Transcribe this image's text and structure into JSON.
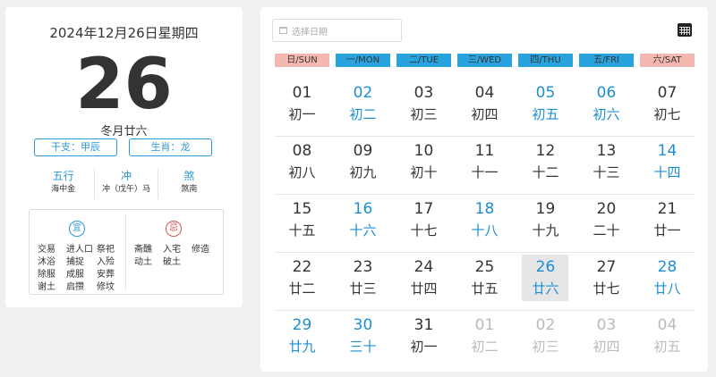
{
  "left": {
    "full_date": "2024年12月26日星期四",
    "big_day": "26",
    "lunar": "冬月廿六",
    "ganzhi": "干支：甲辰",
    "shengxiao": "生肖：龙",
    "wuxing": {
      "title": "五行",
      "value": "海中金"
    },
    "chong": {
      "title": "冲",
      "value": "冲（戊午）马"
    },
    "sha": {
      "title": "煞",
      "value": "煞南"
    },
    "yi": {
      "badge": "宜",
      "items": [
        "交易",
        "进人口",
        "祭祀",
        "沐浴",
        "捕捉",
        "入殓",
        "除服",
        "成服",
        "安葬",
        "谢土",
        "启攒",
        "修坟"
      ]
    },
    "ji": {
      "badge": "忌",
      "items": [
        "斋醮",
        "入宅",
        "修造",
        "动土",
        "破土"
      ]
    }
  },
  "right": {
    "date_placeholder": "选择日期",
    "weekdays": [
      "日/SUN",
      "一/MON",
      "二/TUE",
      "三/WED",
      "四/THU",
      "五/FRI",
      "六/SAT"
    ],
    "weeks": [
      [
        {
          "d": "01",
          "l": "初一",
          "s": "n"
        },
        {
          "d": "02",
          "l": "初二",
          "s": "h"
        },
        {
          "d": "03",
          "l": "初三",
          "s": "n"
        },
        {
          "d": "04",
          "l": "初四",
          "s": "n"
        },
        {
          "d": "05",
          "l": "初五",
          "s": "h"
        },
        {
          "d": "06",
          "l": "初六",
          "s": "h"
        },
        {
          "d": "07",
          "l": "初七",
          "s": "n"
        }
      ],
      [
        {
          "d": "08",
          "l": "初八",
          "s": "n"
        },
        {
          "d": "09",
          "l": "初九",
          "s": "n"
        },
        {
          "d": "10",
          "l": "初十",
          "s": "n"
        },
        {
          "d": "11",
          "l": "十一",
          "s": "n"
        },
        {
          "d": "12",
          "l": "十二",
          "s": "n"
        },
        {
          "d": "13",
          "l": "十三",
          "s": "n"
        },
        {
          "d": "14",
          "l": "十四",
          "s": "h"
        }
      ],
      [
        {
          "d": "15",
          "l": "十五",
          "s": "n"
        },
        {
          "d": "16",
          "l": "十六",
          "s": "h"
        },
        {
          "d": "17",
          "l": "十七",
          "s": "n"
        },
        {
          "d": "18",
          "l": "十八",
          "s": "h"
        },
        {
          "d": "19",
          "l": "十九",
          "s": "n"
        },
        {
          "d": "20",
          "l": "二十",
          "s": "n"
        },
        {
          "d": "21",
          "l": "廿一",
          "s": "n"
        }
      ],
      [
        {
          "d": "22",
          "l": "廿二",
          "s": "n"
        },
        {
          "d": "23",
          "l": "廿三",
          "s": "n"
        },
        {
          "d": "24",
          "l": "廿四",
          "s": "n"
        },
        {
          "d": "25",
          "l": "廿五",
          "s": "n"
        },
        {
          "d": "26",
          "l": "廿六",
          "s": "t"
        },
        {
          "d": "27",
          "l": "廿七",
          "s": "n"
        },
        {
          "d": "28",
          "l": "廿八",
          "s": "h"
        }
      ],
      [
        {
          "d": "29",
          "l": "廿九",
          "s": "h"
        },
        {
          "d": "30",
          "l": "三十",
          "s": "h"
        },
        {
          "d": "31",
          "l": "初一",
          "s": "n"
        },
        {
          "d": "01",
          "l": "初二",
          "s": "o"
        },
        {
          "d": "02",
          "l": "初三",
          "s": "o"
        },
        {
          "d": "03",
          "l": "初四",
          "s": "o"
        },
        {
          "d": "04",
          "l": "初五",
          "s": "o"
        }
      ]
    ]
  },
  "colors": {
    "accent": "#2b97d6",
    "holiday": "#1c8fd3",
    "weekend_header": "#f4b8b0",
    "weekday_header": "#29a3dd",
    "ji": "#d9534f"
  }
}
